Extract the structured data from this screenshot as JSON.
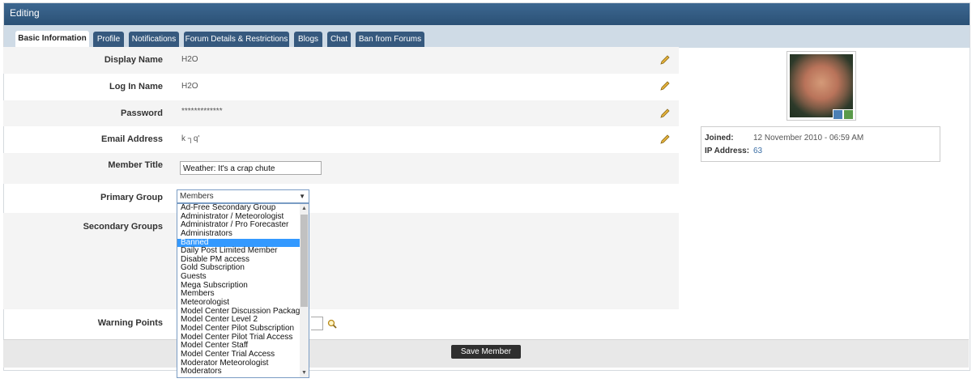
{
  "window": {
    "title": "Editing"
  },
  "tabs": [
    {
      "label": "Basic Information",
      "active": true
    },
    {
      "label": "Profile"
    },
    {
      "label": "Notifications"
    },
    {
      "label": "Forum Details & Restrictions"
    },
    {
      "label": "Blogs"
    },
    {
      "label": "Chat"
    },
    {
      "label": "Ban from Forums"
    }
  ],
  "fields": {
    "display_name": {
      "label": "Display Name",
      "value": "H2O"
    },
    "login_name": {
      "label": "Log In Name",
      "value": "H2O"
    },
    "password": {
      "label": "Password",
      "value": "*************"
    },
    "email": {
      "label": "Email Address",
      "value": "k ┐q'"
    },
    "member_title": {
      "label": "Member Title",
      "value": "Weather: It's a crap chute"
    },
    "primary_group": {
      "label": "Primary Group",
      "value": "Members",
      "options": [
        "Ad-Free Secondary Group",
        "Administrator / Meteorologist",
        "Administrator / Pro Forecaster",
        "Administrators",
        "Banned",
        "Daily Post Limited Member",
        "Disable PM access",
        "Gold Subscription",
        "Guests",
        "Mega Subscription",
        "Members",
        "Meteorologist",
        "Model Center Discussion Package",
        "Model Center Level 2",
        "Model Center Pilot Subscription",
        "Model Center Pilot Trial Access",
        "Model Center Staff",
        "Model Center Trial Access",
        "Moderator Meteorologist",
        "Moderators"
      ],
      "highlighted": "Banned"
    },
    "secondary_groups": {
      "label": "Secondary Groups"
    },
    "warning_points": {
      "label": "Warning Points"
    }
  },
  "info": {
    "joined_label": "Joined:",
    "joined_value": "12 November 2010 - 06:59 AM",
    "ip_label": "IP Address:",
    "ip_value": "63"
  },
  "footer": {
    "save_label": "Save Member"
  },
  "colors": {
    "titlebar": "#2b5176",
    "tab": "#36597e",
    "highlight": "#3399ff"
  }
}
